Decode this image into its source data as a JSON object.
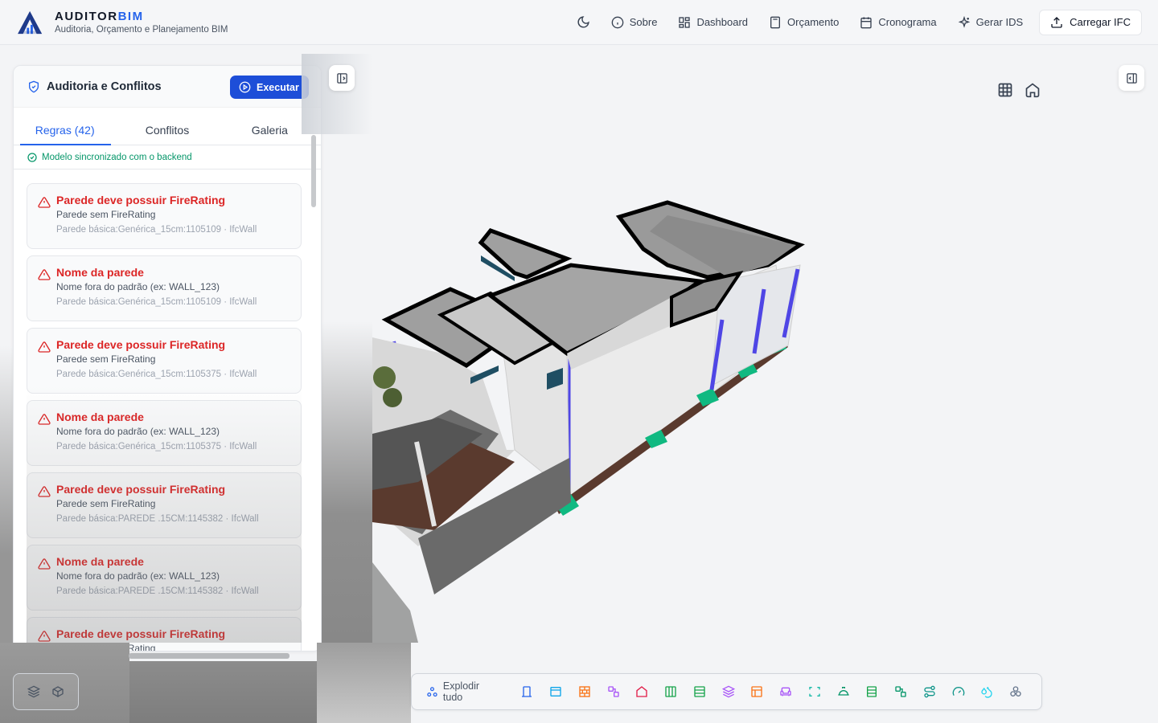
{
  "header": {
    "brand_main": "AUDITOR",
    "brand_accent": "BIM",
    "subtitle": "Auditoria, Orçamento e Planejamento BIM",
    "nav": [
      {
        "label": "Sobre",
        "icon": "info-icon"
      },
      {
        "label": "Dashboard",
        "icon": "dashboard-icon"
      },
      {
        "label": "Orçamento",
        "icon": "calculator-icon"
      },
      {
        "label": "Cronograma",
        "icon": "calendar-icon"
      },
      {
        "label": "Gerar IDS",
        "icon": "sparkles-icon"
      }
    ],
    "upload_label": "Carregar IFC"
  },
  "panel": {
    "title": "Auditoria e Conflitos",
    "run_label": "Executar",
    "tabs": [
      "Regras (42)",
      "Conflitos",
      "Galeria"
    ],
    "active_tab": 0,
    "sync_status": "Modelo sincronizado com o backend",
    "rules": [
      {
        "title": "Parede deve possuir FireRating",
        "desc": "Parede sem FireRating",
        "meta": "Parede básica:Genérica_15cm:1105109 · IfcWall"
      },
      {
        "title": "Nome da parede",
        "desc": "Nome fora do padrão (ex: WALL_123)",
        "meta": "Parede básica:Genérica_15cm:1105109 · IfcWall"
      },
      {
        "title": "Parede deve possuir FireRating",
        "desc": "Parede sem FireRating",
        "meta": "Parede básica:Genérica_15cm:1105375 · IfcWall"
      },
      {
        "title": "Nome da parede",
        "desc": "Nome fora do padrão (ex: WALL_123)",
        "meta": "Parede básica:Genérica_15cm:1105375 · IfcWall"
      },
      {
        "title": "Parede deve possuir FireRating",
        "desc": "Parede sem FireRating",
        "meta": "Parede básica:PAREDE .15CM:1145382 · IfcWall"
      },
      {
        "title": "Nome da parede",
        "desc": "Nome fora do padrão (ex: WALL_123)",
        "meta": "Parede básica:PAREDE .15CM:1145382 · IfcWall"
      },
      {
        "title": "Parede deve possuir FireRating",
        "desc": "Parede sem FireRating",
        "meta": ""
      }
    ]
  },
  "toolbar": {
    "explode_label": "Explodir tudo",
    "tools": [
      {
        "icon": "door-icon",
        "color": "#2563eb"
      },
      {
        "icon": "window-icon",
        "color": "#0ea5e9"
      },
      {
        "icon": "brick-wall-icon",
        "color": "#f97316"
      },
      {
        "icon": "beam-icon",
        "color": "#a855f7"
      },
      {
        "icon": "house-icon",
        "color": "#e11d48"
      },
      {
        "icon": "columns-icon",
        "color": "#16a34a"
      },
      {
        "icon": "slab-icon",
        "color": "#16a34a"
      },
      {
        "icon": "layers-icon",
        "color": "#a855f7"
      },
      {
        "icon": "layout-icon",
        "color": "#f97316"
      },
      {
        "icon": "furniture-icon",
        "color": "#a855f7"
      },
      {
        "icon": "space-icon",
        "color": "#14b8a6"
      },
      {
        "icon": "roof-icon",
        "color": "#059669"
      },
      {
        "icon": "stairs-icon",
        "color": "#16a34a"
      },
      {
        "icon": "pipe-icon",
        "color": "#059669"
      },
      {
        "icon": "route-icon",
        "color": "#0d9488"
      },
      {
        "icon": "gauge-icon",
        "color": "#0d9488"
      },
      {
        "icon": "droplets-icon",
        "color": "#22d3ee"
      },
      {
        "icon": "cluster-icon",
        "color": "#64748b"
      }
    ]
  },
  "colors": {
    "accent": "#2563eb",
    "error": "#dc2626",
    "success": "#059669"
  }
}
